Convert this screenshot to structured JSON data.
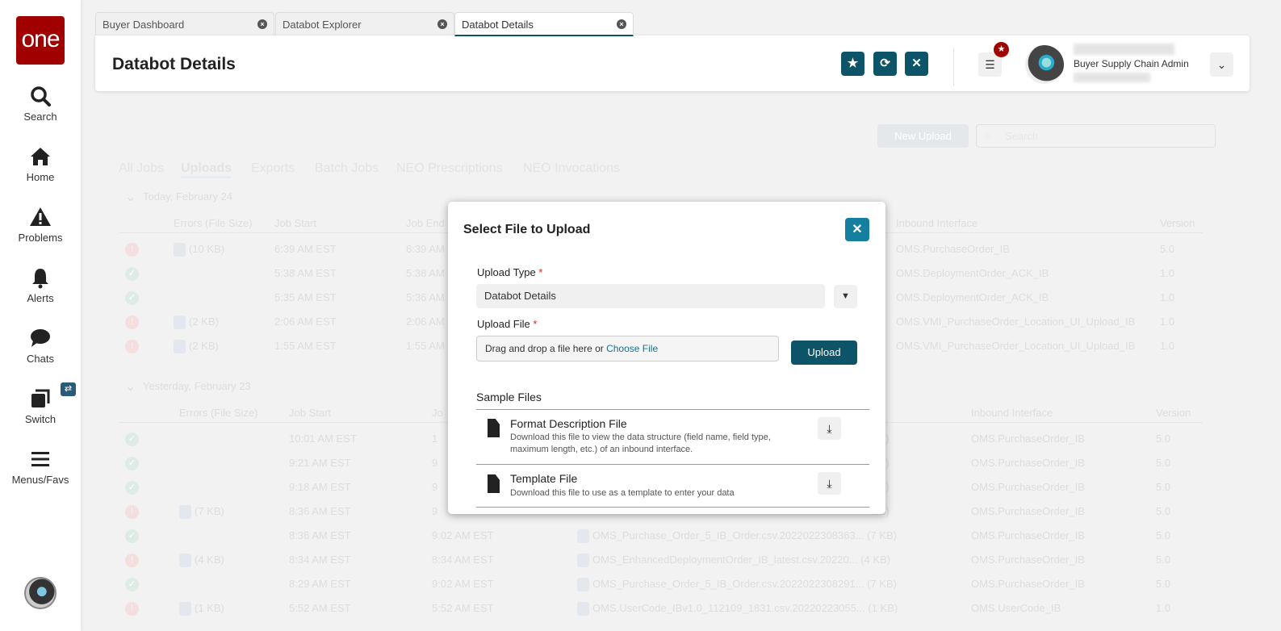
{
  "sidebar": {
    "logo": "one",
    "items": [
      {
        "label": "Search",
        "icon": "search-icon"
      },
      {
        "label": "Home",
        "icon": "home-icon"
      },
      {
        "label": "Problems",
        "icon": "warning-icon"
      },
      {
        "label": "Alerts",
        "icon": "bell-icon"
      },
      {
        "label": "Chats",
        "icon": "chat-icon"
      },
      {
        "label": "Switch",
        "icon": "switch-icon",
        "badge": "⇄"
      },
      {
        "label": "Menus/Favs",
        "icon": "menu-icon"
      }
    ]
  },
  "tabs": [
    {
      "label": "Buyer Dashboard"
    },
    {
      "label": "Databot Explorer"
    },
    {
      "label": "Databot Details",
      "active": true
    }
  ],
  "header": {
    "title": "Databot Details",
    "role": "Buyer Supply Chain Admin"
  },
  "toolbar": {
    "new_upload": "New Upload",
    "search_placeholder": "Search"
  },
  "job_tabs": [
    "All Jobs",
    "Uploads",
    "Exports",
    "Batch Jobs",
    "NEO Prescriptions",
    "NEO Invocations"
  ],
  "active_job_tab": "Uploads",
  "groups": [
    {
      "label": "Today, February 24",
      "columns": [
        "Errors (File Size)",
        "Job Start",
        "Job End",
        "Inbound Interface",
        "Version"
      ],
      "rows": [
        {
          "status": "error",
          "errors": "(10 KB)",
          "start": "6:39 AM EST",
          "end": "6:39 AM",
          "interface": "OMS.PurchaseOrder_IB",
          "version": "5.0"
        },
        {
          "status": "ok",
          "errors": "",
          "start": "5:38 AM EST",
          "end": "5:38 AM",
          "interface": "OMS.DeploymentOrder_ACK_IB",
          "version": "1.0"
        },
        {
          "status": "ok",
          "errors": "",
          "start": "5:35 AM EST",
          "end": "5:36 AM",
          "interface": "OMS.DeploymentOrder_ACK_IB",
          "version": "1.0"
        },
        {
          "status": "error",
          "errors": "(2 KB)",
          "start": "2:06 AM EST",
          "end": "2:06 AM",
          "interface": "OMS.VMI_PurchaseOrder_Location_UI_Upload_IB",
          "version": "1.0"
        },
        {
          "status": "error",
          "errors": "(2 KB)",
          "start": "1:55 AM EST",
          "end": "1:55 AM",
          "interface": "OMS.VMI_PurchaseOrder_Location_UI_Upload_IB",
          "version": "1.0"
        }
      ]
    },
    {
      "label": "Yesterday, February 23",
      "columns": [
        "Errors (File Size)",
        "Job Start",
        "Jo",
        "Inbound Interface",
        "Version"
      ],
      "rows": [
        {
          "status": "ok",
          "errors": "",
          "start": "10:01 AM EST",
          "end": "1",
          "file": "KB)",
          "interface": "OMS.PurchaseOrder_IB",
          "version": "5.0"
        },
        {
          "status": "ok",
          "errors": "",
          "start": "9:21 AM EST",
          "end": "9",
          "file": "KB)",
          "interface": "OMS.PurchaseOrder_IB",
          "version": "5.0"
        },
        {
          "status": "ok",
          "errors": "",
          "start": "9:18 AM EST",
          "end": "9",
          "file": "KB)",
          "interface": "OMS.PurchaseOrder_IB",
          "version": "5.0"
        },
        {
          "status": "error",
          "errors": "(7 KB)",
          "start": "8:36 AM EST",
          "end": "9",
          "file": "KB)",
          "interface": "OMS.PurchaseOrder_IB",
          "version": "5.0"
        },
        {
          "status": "ok",
          "errors": "",
          "start": "8:36 AM EST",
          "end": "9:02 AM EST",
          "file": "OMS_Purchase_Order_5_IB_Order.csv.2022022308363... (7 KB)",
          "interface": "OMS.PurchaseOrder_IB",
          "version": "5.0"
        },
        {
          "status": "error",
          "errors": "(4 KB)",
          "start": "8:34 AM EST",
          "end": "8:34 AM EST",
          "file": "OMS_EnhancedDeploymentOrder_IB_latest.csv.20220... (4 KB)",
          "interface": "OMS.PurchaseOrder_IB",
          "version": "5.0"
        },
        {
          "status": "ok",
          "errors": "",
          "start": "8:29 AM EST",
          "end": "9:02 AM EST",
          "file": "OMS_Purchase_Order_5_IB_Order.csv.2022022308291... (7 KB)",
          "interface": "OMS.PurchaseOrder_IB",
          "version": "5.0"
        },
        {
          "status": "error",
          "errors": "(1 KB)",
          "start": "5:52 AM EST",
          "end": "5:52 AM EST",
          "file": "OMS.UserCode_IBv1.0_112109_1831.csv.20220223055... (1 KB)",
          "interface": "OMS.UserCode_IB",
          "version": "1.0"
        }
      ]
    }
  ],
  "modal": {
    "title": "Select File to Upload",
    "upload_type_label": "Upload Type",
    "required_mark": "*",
    "upload_type_value": "Databot Details",
    "upload_file_label": "Upload File",
    "drop_text": "Drag and drop a file here or ",
    "choose_file": "Choose File",
    "upload_button": "Upload",
    "sample_files_label": "Sample Files",
    "files": [
      {
        "title": "Format Description File",
        "desc": "Download this file to view the data structure (field name, field type, maximum length, etc.) of an inbound interface."
      },
      {
        "title": "Template File",
        "desc": "Download this file to use as a template to enter your data"
      }
    ]
  },
  "colors": {
    "brand": "#a00000",
    "primary": "#0d5468",
    "close": "#157fa0"
  }
}
